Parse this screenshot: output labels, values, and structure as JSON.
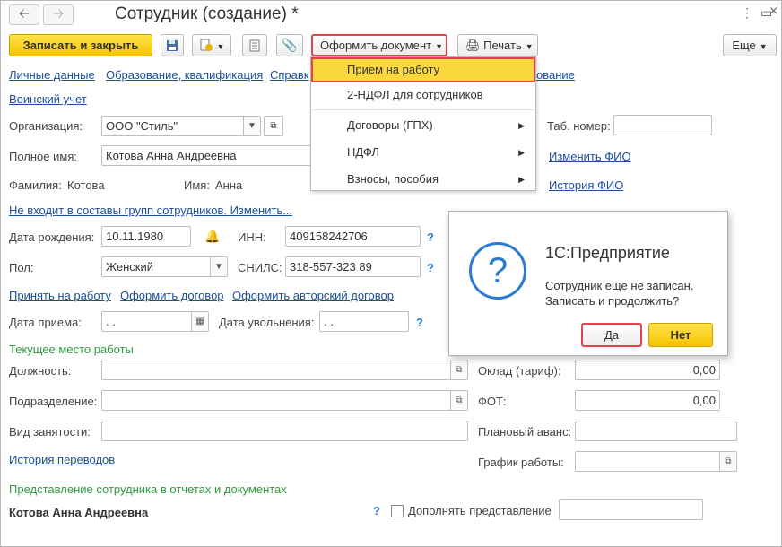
{
  "window": {
    "title": "Сотрудник (создание) *",
    "back_icon": "arrow-left-icon",
    "forward_icon": "arrow-right-icon",
    "more_glyph": "⋮",
    "restore_glyph": "▭",
    "close_glyph": "×"
  },
  "toolbar": {
    "save_close": "Записать и закрыть",
    "make_document": "Оформить документ",
    "print": "Печать",
    "more": "Еще"
  },
  "menu": {
    "items": [
      {
        "label": "Прием на работу",
        "has_submenu": false
      },
      {
        "label": "2-НДФЛ для сотрудников",
        "has_submenu": false
      },
      {
        "label": "Договоры (ГПХ)",
        "has_submenu": true
      },
      {
        "label": "НДФЛ",
        "has_submenu": true
      },
      {
        "label": "Взносы, пособия",
        "has_submenu": true
      }
    ]
  },
  "nav_links": {
    "personal": "Личные данные",
    "education": "Образование, квалификация",
    "reference": "Справк",
    "tail": "ование",
    "military": "Воинский учет"
  },
  "form": {
    "org_label": "Организация:",
    "org_value": "ООО \"Стиль\"",
    "fullname_label": "Полное имя:",
    "fullname_value": "Котова Анна Андреевна",
    "lastname_label": "Фамилия:",
    "lastname_value": "Котова",
    "firstname_label": "Имя:",
    "firstname_value": "Анна",
    "tab_label": "Таб. номер:",
    "tab_value": "",
    "change_fio": "Изменить ФИО",
    "history_fio": "История ФИО",
    "groups_link": "Не входит в составы групп сотрудников. Изменить...",
    "birth_label": "Дата рождения:",
    "birth_value": "10.11.1980",
    "inn_label": "ИНН:",
    "inn_value": "409158242706",
    "gender_label": "Пол:",
    "gender_value": "Женский",
    "snils_label": "СНИЛС:",
    "snils_value": "318-557-323 89",
    "hire_link": "Принять на работу",
    "contract_link": "Оформить договор",
    "author_link": "Оформить авторский договор",
    "hire_date_label": "Дата приема:",
    "hire_date_value": " .  .",
    "dismiss_label": "Дата увольнения:",
    "dismiss_value": " .  .",
    "section_current": "Текущее место работы",
    "position_label": "Должность:",
    "dept_label": "Подразделение:",
    "employment_label": "Вид занятости:",
    "salary_label": "Оклад (тариф):",
    "salary_value": "0,00",
    "fot_label": "ФОТ:",
    "fot_value": "0,00",
    "advance_label": "Плановый аванс:",
    "schedule_label": "График работы:",
    "transfer_history": "История переводов",
    "section_repr": "Представление сотрудника в отчетах и документах",
    "repr_name": "Котова Анна Андреевна",
    "extend_label": "Дополнять представление",
    "help": "?"
  },
  "dialog": {
    "title": "1С:Предприятие",
    "line1": "Сотрудник еще не записан.",
    "line2": "Записать и продолжить?",
    "yes": "Да",
    "no": "Нет",
    "icon": "question-icon"
  }
}
